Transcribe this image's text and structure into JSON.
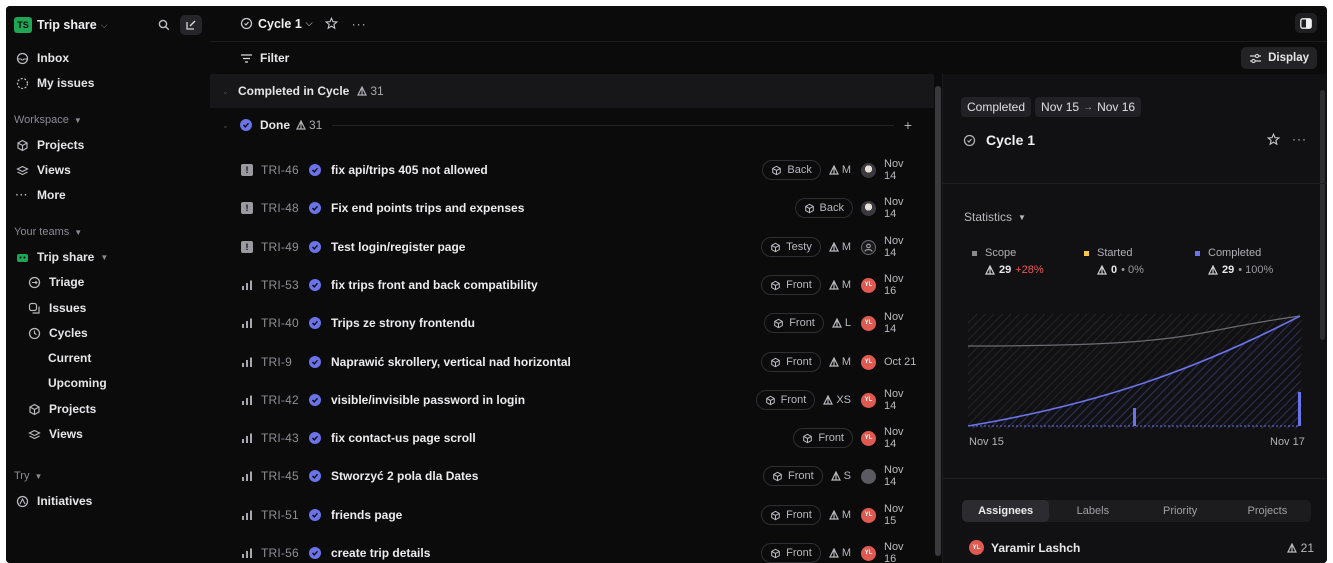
{
  "sidebar": {
    "workspace_badge": "TS",
    "workspace_name": "Trip share",
    "inbox": "Inbox",
    "my_issues": "My issues",
    "workspace_label": "Workspace",
    "projects": "Projects",
    "views": "Views",
    "more": "More",
    "teams_label": "Your teams",
    "team_name": "Trip share",
    "triage": "Triage",
    "issues": "Issues",
    "cycles": "Cycles",
    "current": "Current",
    "upcoming": "Upcoming",
    "team_projects": "Projects",
    "team_views": "Views",
    "try_label": "Try",
    "initiatives": "Initiatives"
  },
  "topbar": {
    "cycle_name": "Cycle 1",
    "filter_label": "Filter",
    "display_label": "Display"
  },
  "list": {
    "group_label": "Completed in Cycle",
    "group_count": "31",
    "status_label": "Done",
    "status_count": "31",
    "issues": [
      {
        "id": "TRI-46",
        "title": "fix api/trips 405 not allowed",
        "label": "Back",
        "estimate": "M",
        "avatar": "photo",
        "date": "Nov 14",
        "priority": "urgent"
      },
      {
        "id": "TRI-48",
        "title": "Fix end points trips and expenses",
        "label": "Back",
        "estimate": "",
        "avatar": "photo",
        "date": "Nov 14",
        "priority": "urgent"
      },
      {
        "id": "TRI-49",
        "title": "Test login/register page",
        "label": "Testy",
        "estimate": "M",
        "avatar": "blank",
        "date": "Nov 14",
        "priority": "urgent"
      },
      {
        "id": "TRI-53",
        "title": "fix trips front and back compatibility",
        "label": "Front",
        "estimate": "M",
        "avatar": "YL",
        "date": "Nov 16",
        "priority": "bars"
      },
      {
        "id": "TRI-40",
        "title": "Trips ze strony frontendu",
        "label": "Front",
        "estimate": "L",
        "avatar": "YL",
        "date": "Nov 14",
        "priority": "bars"
      },
      {
        "id": "TRI-9",
        "title": "Naprawić skrollery, vertical nad horizontal",
        "label": "Front",
        "estimate": "M",
        "avatar": "YL",
        "date": "Oct 21",
        "priority": "bars"
      },
      {
        "id": "TRI-42",
        "title": "visible/invisible password in login",
        "label": "Front",
        "estimate": "XS",
        "avatar": "YL",
        "date": "Nov 14",
        "priority": "bars"
      },
      {
        "id": "TRI-43",
        "title": "fix contact-us page scroll",
        "label": "Front",
        "estimate": "",
        "avatar": "YL",
        "date": "Nov 14",
        "priority": "bars"
      },
      {
        "id": "TRI-45",
        "title": "Stworzyć 2 pola dla Dates",
        "label": "Front",
        "estimate": "S",
        "avatar": "gray",
        "date": "Nov 14",
        "priority": "bars"
      },
      {
        "id": "TRI-51",
        "title": "friends page",
        "label": "Front",
        "estimate": "M",
        "avatar": "YL",
        "date": "Nov 15",
        "priority": "bars"
      },
      {
        "id": "TRI-56",
        "title": "create trip details",
        "label": "Front",
        "estimate": "M",
        "avatar": "YL",
        "date": "Nov 16",
        "priority": "bars"
      }
    ]
  },
  "panel": {
    "status_chip": "Completed",
    "date_start": "Nov 15",
    "date_end": "Nov 16",
    "title": "Cycle 1",
    "statistics_label": "Statistics",
    "scope_label": "Scope",
    "scope_value": "29",
    "scope_change": "+28%",
    "started_label": "Started",
    "started_value": "0",
    "started_change": "• 0%",
    "completed_label": "Completed",
    "completed_value": "29",
    "completed_change": "• 100%",
    "x_start": "Nov 15",
    "x_end": "Nov 17",
    "tabs": [
      "Assignees",
      "Labels",
      "Priority",
      "Projects"
    ],
    "assignee_name": "Yaramir Lashch",
    "assignee_count": "21",
    "avatar_initials": "YL"
  },
  "colors": {
    "accent": "#6a73e8",
    "scope_dot": "#8a8a90",
    "started_dot": "#f2c94c",
    "completed_dot": "#6a73e8",
    "scope_change": "#eb5757",
    "avatar_red": "#e05a52",
    "workspace_badge": "#1fa554"
  }
}
